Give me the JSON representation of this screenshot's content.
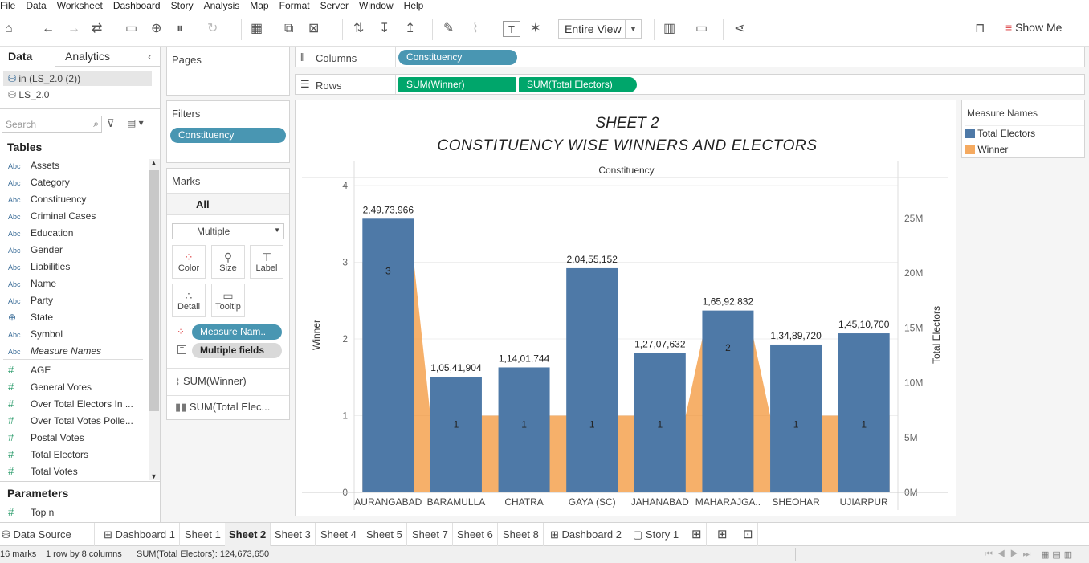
{
  "menu": [
    "File",
    "Data",
    "Worksheet",
    "Dashboard",
    "Story",
    "Analysis",
    "Map",
    "Format",
    "Server",
    "Window",
    "Help"
  ],
  "toolbar": {
    "view_select": "Entire View",
    "show_me": "Show Me"
  },
  "data_pane": {
    "tabs": [
      "Data",
      "Analytics"
    ],
    "data_sources": [
      "in (LS_2.0 (2))",
      "LS_2.0"
    ],
    "search_placeholder": "Search",
    "tables_header": "Tables",
    "dimensions": [
      "Assets",
      "Category",
      "Constituency",
      "Criminal Cases",
      "Education",
      "Gender",
      "Liabilities",
      "Name",
      "Party",
      "State",
      "Symbol",
      "Measure Names"
    ],
    "measures": [
      "AGE",
      "General Votes",
      "Over Total Electors  In ...",
      "Over Total Votes Polle...",
      "Postal Votes",
      "Total Electors",
      "Total Votes"
    ],
    "parameters_header": "Parameters",
    "parameters": [
      "Top n"
    ]
  },
  "shelves": {
    "pages": "Pages",
    "columns_label": "Columns",
    "columns_pill": "Constituency",
    "rows_label": "Rows",
    "rows_pills": [
      "SUM(Winner)",
      "SUM(Total Electors)"
    ],
    "filters": "Filters",
    "filter_pill": "Constituency"
  },
  "marks": {
    "title": "Marks",
    "all": "All",
    "type": "Multiple",
    "buttons": [
      "Color",
      "Size",
      "Label",
      "Detail",
      "Tooltip"
    ],
    "pills": [
      "Measure Nam..",
      "Multiple fields"
    ],
    "measures": [
      "SUM(Winner)",
      "SUM(Total Elec..."
    ]
  },
  "chart_data": {
    "type": "bar",
    "title": "SHEET 2",
    "subtitle": "CONSTITUENCY WISE WINNERS AND ELECTORS",
    "column_header": "Constituency",
    "categories": [
      "AURANGABAD",
      "BARAMULLA",
      "CHATRA",
      "GAYA (SC)",
      "JAHANABAD",
      "MAHARAJGA..",
      "SHEOHAR",
      "UJIARPUR"
    ],
    "series": [
      {
        "name": "Total Electors",
        "mark": "bar",
        "axis": "right",
        "color": "#4e79a7",
        "values": [
          24973966,
          10541904,
          11401744,
          20455152,
          12707632,
          16592832,
          13489720,
          14510700
        ],
        "labels": [
          "2,49,73,966",
          "1,05,41,904",
          "1,14,01,744",
          "2,04,55,152",
          "1,27,07,632",
          "1,65,92,832",
          "1,34,89,720",
          "1,45,10,700"
        ]
      },
      {
        "name": "Winner",
        "mark": "area",
        "axis": "left",
        "color": "#f28e2b",
        "values": [
          3,
          1,
          1,
          1,
          1,
          2,
          1,
          1
        ],
        "labels": [
          "3",
          "1",
          "1",
          "1",
          "1",
          "2",
          "1",
          "1"
        ]
      }
    ],
    "ylabel_left": "Winner",
    "ylim_left": [
      0,
      4
    ],
    "yticks_left": [
      "0",
      "1",
      "2",
      "3",
      "4"
    ],
    "ylabel_right": "Total Electors",
    "ylim_right": [
      0,
      28000000
    ],
    "yticks_right": [
      "0M",
      "5M",
      "10M",
      "15M",
      "20M",
      "25M"
    ],
    "legend_title": "Measure Names",
    "legend_position": "right"
  },
  "sheet_tabs": [
    "Data Source",
    "Dashboard 1",
    "Sheet 1",
    "Sheet 2",
    "Sheet 3",
    "Sheet 4",
    "Sheet 5",
    "Sheet 7",
    "Sheet 6",
    "Sheet 8",
    "Dashboard 2",
    "Story 1"
  ],
  "active_tab": "Sheet 2",
  "status": {
    "marks": "16 marks",
    "dims": "1 row by 8 columns",
    "sum": "SUM(Total Electors): 124,673,650"
  }
}
